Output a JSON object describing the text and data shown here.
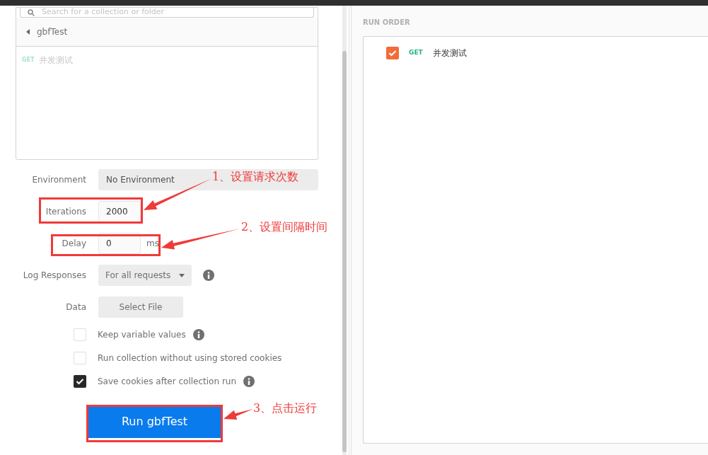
{
  "collection_picker": {
    "search": {
      "placeholder": "Search for a collection or folder"
    },
    "collection": {
      "name": "gbfTest"
    },
    "requests": [
      {
        "method": "GET",
        "name": "并发测试"
      }
    ]
  },
  "settings": {
    "environment": {
      "label": "Environment",
      "value": "No Environment"
    },
    "iterations": {
      "label": "Iterations",
      "value": "2000"
    },
    "delay": {
      "label": "Delay",
      "value": "0",
      "unit": "ms"
    },
    "log_responses": {
      "label": "Log Responses",
      "value": "For all requests"
    },
    "data": {
      "label": "Data",
      "button": "Select File"
    },
    "options": [
      {
        "label": "Keep variable values",
        "checked": false,
        "info": true
      },
      {
        "label": "Run collection without using stored cookies",
        "checked": false,
        "info": false
      },
      {
        "label": "Save cookies after collection run",
        "checked": true,
        "info": true
      }
    ],
    "run_button": "Run gbfTest"
  },
  "run_order": {
    "title": "RUN ORDER",
    "items": [
      {
        "method": "GET",
        "name": "并发测试",
        "checked": true
      }
    ]
  },
  "annotations": [
    {
      "text": "1、设置请求次数"
    },
    {
      "text": "2、设置间隔时间"
    },
    {
      "text": "3、点击运行"
    }
  ]
}
